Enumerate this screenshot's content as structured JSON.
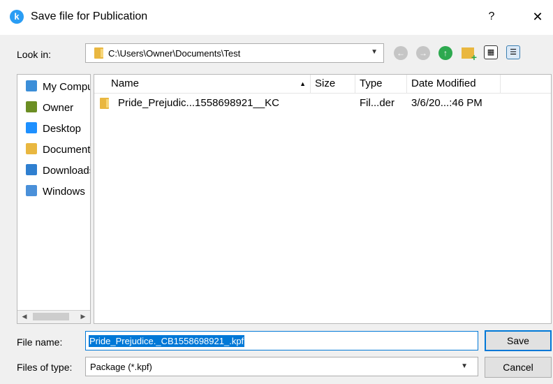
{
  "window": {
    "app_icon_glyph": "k",
    "title": "Save file for Publication",
    "help_label": "?",
    "close_label": "✕"
  },
  "lookin": {
    "label": "Look in:",
    "path": "C:\\Users\\Owner\\Documents\\Test"
  },
  "toolbar": {
    "back_icon": "back-arrow-icon",
    "forward_icon": "forward-arrow-icon",
    "up_icon": "up-arrow-icon",
    "new_folder_icon": "new-folder-icon",
    "list_view_icon": "list-view-icon",
    "detail_view_icon": "detail-view-icon"
  },
  "sidebar": {
    "items": [
      {
        "label": "My Computer",
        "icon": "computer-icon",
        "color": "#3b8ed8"
      },
      {
        "label": "Owner",
        "icon": "user-icon",
        "color": "#6b8e23"
      },
      {
        "label": "Desktop",
        "icon": "desktop-icon",
        "color": "#1e90ff"
      },
      {
        "label": "Documents",
        "icon": "documents-icon",
        "color": "#e9b740"
      },
      {
        "label": "Downloads",
        "icon": "downloads-icon",
        "color": "#2f7fd0"
      },
      {
        "label": "Windows",
        "icon": "drive-icon",
        "color": "#4a90d9"
      }
    ]
  },
  "filelist": {
    "columns": {
      "name": "Name",
      "size": "Size",
      "type": "Type",
      "date": "Date Modified"
    },
    "rows": [
      {
        "name": "Pride_Prejudic...1558698921__KC",
        "size": "",
        "type": "Fil...der",
        "date": "3/6/20...:46 PM"
      }
    ]
  },
  "filename": {
    "label": "File name:",
    "value": "Pride_Prejudice._CB1558698921_.kpf"
  },
  "filetype": {
    "label": "Files of type:",
    "value": "Package (*.kpf)"
  },
  "buttons": {
    "save": "Save",
    "cancel": "Cancel"
  },
  "colors": {
    "accent": "#0078d7"
  }
}
